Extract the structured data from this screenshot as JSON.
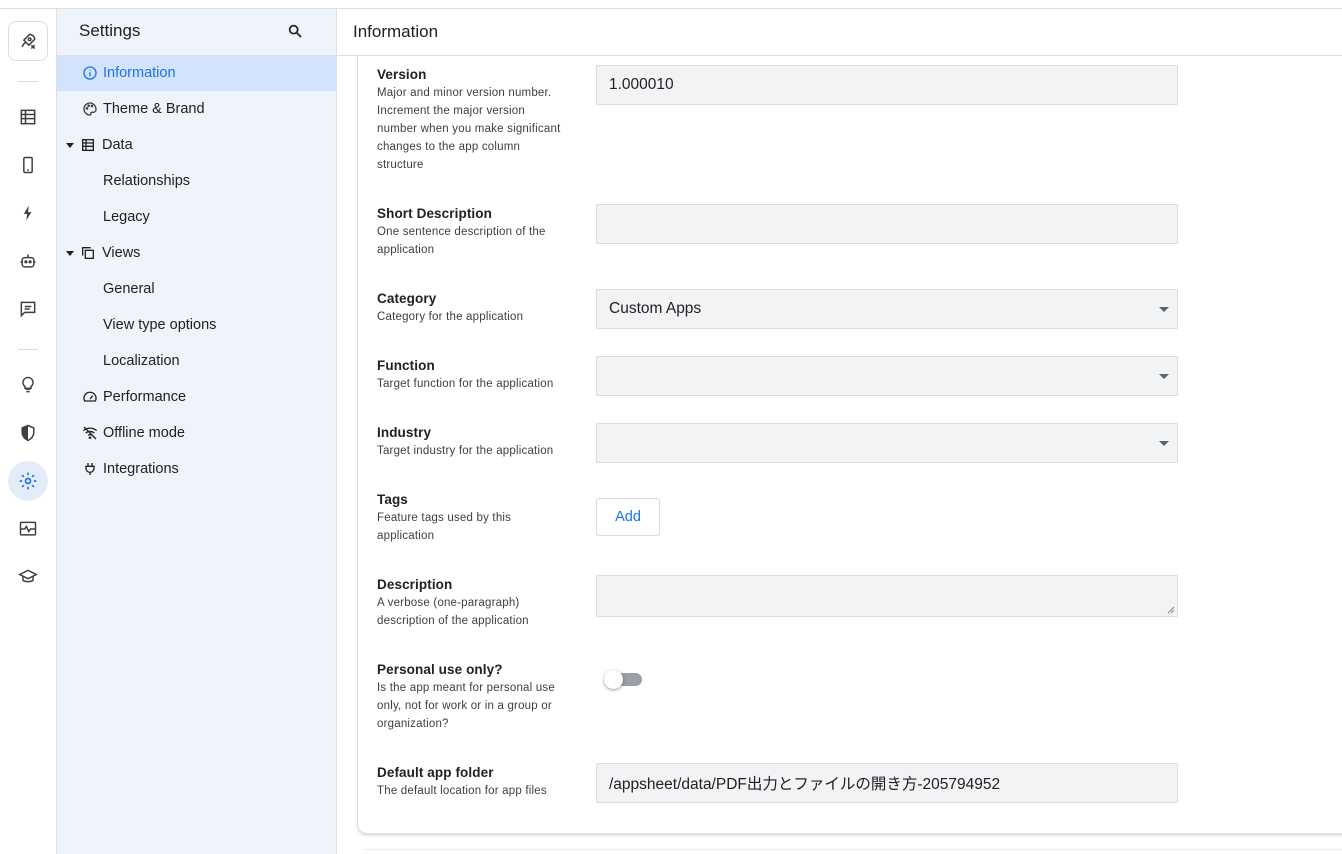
{
  "rail": {
    "icons": [
      "rocket-icon",
      "table-icon",
      "phone-icon",
      "bolt-icon",
      "robot-icon",
      "chat-icon",
      "lightbulb-icon",
      "shield-icon",
      "gear-icon",
      "monitor-pulse-icon",
      "graduation-cap-icon"
    ],
    "active": "gear-icon"
  },
  "nav": {
    "title": "Settings",
    "items": [
      {
        "label": "Information",
        "icon": "info-icon",
        "active": true
      },
      {
        "label": "Theme & Brand",
        "icon": "palette-icon"
      },
      {
        "label": "Data",
        "icon": "table-icon",
        "expanded": true
      },
      {
        "label": "Relationships"
      },
      {
        "label": "Legacy"
      },
      {
        "label": "Views",
        "icon": "copy-icon",
        "expanded": true
      },
      {
        "label": "General"
      },
      {
        "label": "View type options"
      },
      {
        "label": "Localization"
      },
      {
        "label": "Performance",
        "icon": "speedometer-icon"
      },
      {
        "label": "Offline mode",
        "icon": "wifi-off-icon"
      },
      {
        "label": "Integrations",
        "icon": "plug-icon"
      }
    ]
  },
  "header": {
    "title": "Information"
  },
  "fields": {
    "version": {
      "title": "Version",
      "desc": [
        "Major and minor version number.",
        "Increment the major version",
        "number when you make significant",
        "changes to the app column",
        "structure"
      ],
      "value": "1.000010"
    },
    "short_description": {
      "title": "Short Description",
      "desc": [
        "One sentence description of the",
        "application"
      ],
      "value": ""
    },
    "category": {
      "title": "Category",
      "desc": [
        "Category for the application"
      ],
      "value": "Custom Apps"
    },
    "function": {
      "title": "Function",
      "desc": [
        "Target function for the application"
      ],
      "value": ""
    },
    "industry": {
      "title": "Industry",
      "desc": [
        "Target industry for the application"
      ],
      "value": ""
    },
    "tags": {
      "title": "Tags",
      "desc": [
        "Feature tags used by this",
        "application"
      ],
      "button": "Add"
    },
    "description": {
      "title": "Description",
      "desc": [
        "A verbose (one-paragraph)",
        "description of the application"
      ],
      "value": ""
    },
    "personal_use": {
      "title": "Personal use only?",
      "desc": [
        "Is the app meant for personal use",
        "only, not for work or in a group or",
        "organization?"
      ],
      "enabled": false
    },
    "default_folder": {
      "title": "Default app folder",
      "desc": [
        "The default location for app files"
      ],
      "value": "/appsheet/data/PDF出力とファイルの開き方-205794952"
    }
  },
  "colors": {
    "accent": "#1a73e8",
    "nav_bg": "#eff3fb",
    "active_bg": "#d3e3fd",
    "input_bg": "#f1f3f4"
  }
}
